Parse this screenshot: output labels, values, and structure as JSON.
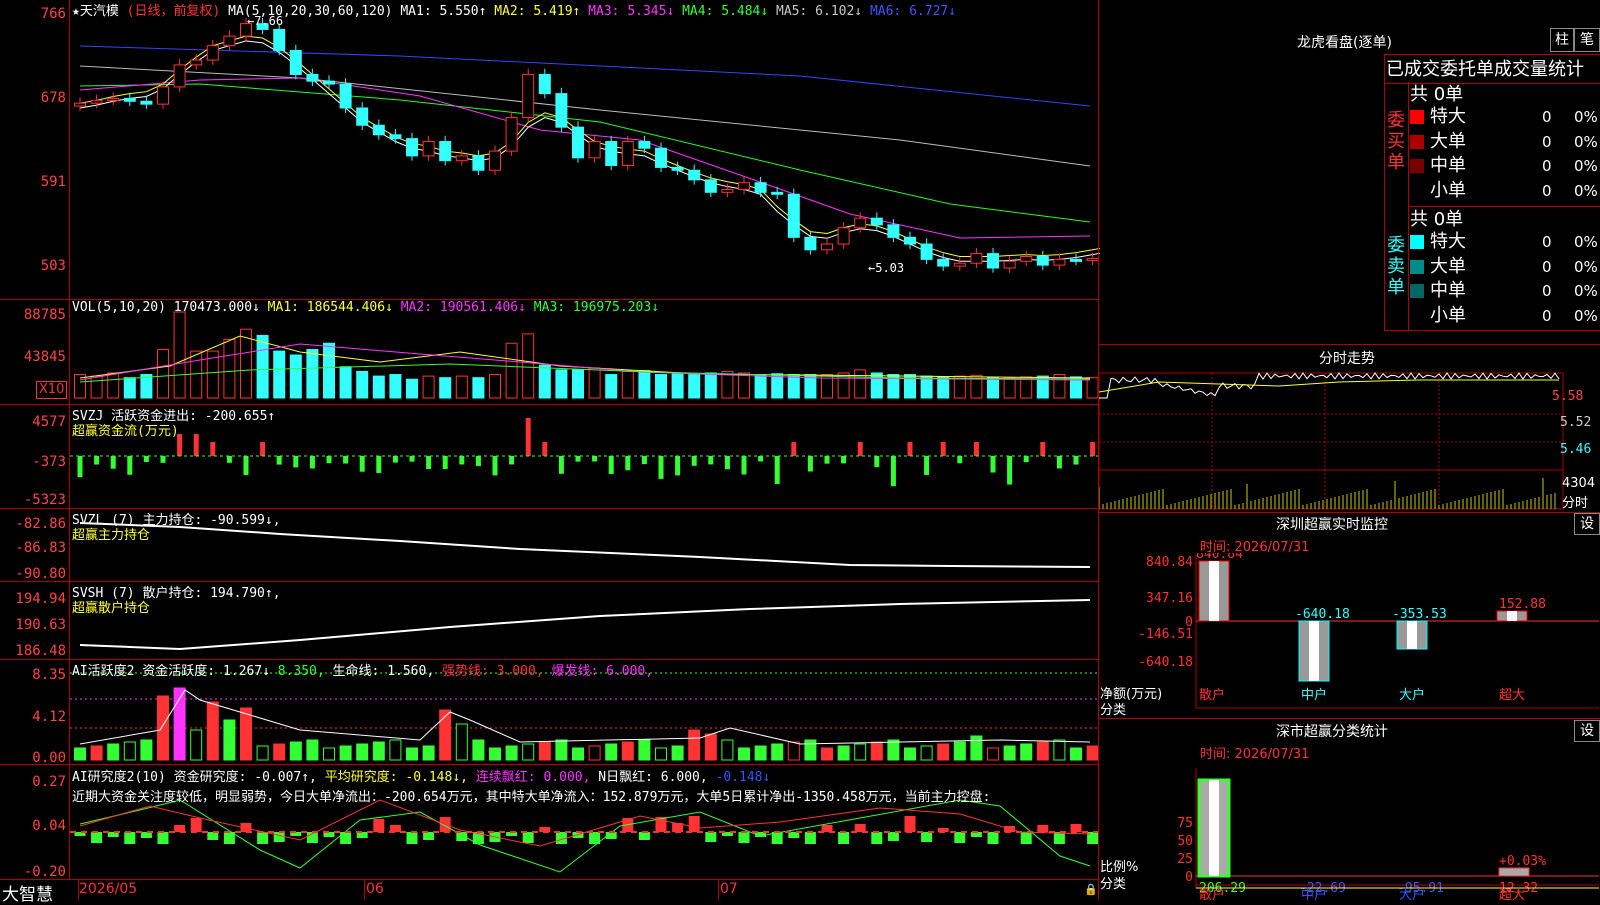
{
  "main": {
    "title": "★天汽模",
    "period": "(日线，前复权)",
    "ma_label": "MA(5,10,20,30,60,120)",
    "ma": [
      {
        "text": "MA1: 5.550↑",
        "color": "#ffffff"
      },
      {
        "text": "MA2: 5.419↑",
        "color": "#ffff33"
      },
      {
        "text": "MA3: 5.345↓",
        "color": "#ff33ff"
      },
      {
        "text": "MA4: 5.484↓",
        "color": "#33ff33"
      },
      {
        "text": "MA5: 6.102↓",
        "color": "#c8c8c8"
      },
      {
        "text": "MA6: 6.727↓",
        "color": "#4455ff"
      }
    ],
    "y_labels": [
      "766",
      "678",
      "591",
      "503"
    ],
    "hi_note": "←7.66",
    "lo_note": "←5.03"
  },
  "vol": {
    "label": "VOL(5,10,20)",
    "items": [
      {
        "text": "170473.000↓",
        "color": "#ffffff"
      },
      {
        "text": "MA1: 186544.406↓",
        "color": "#ffff33"
      },
      {
        "text": "MA2: 190561.406↓",
        "color": "#ff33ff"
      },
      {
        "text": "MA3: 196975.203↓",
        "color": "#33ff33"
      }
    ],
    "y_labels": [
      "88785",
      "43845"
    ],
    "unit": "X10"
  },
  "svzj": {
    "label": "SVZJ  活跃资金进出: -200.655↑",
    "sub": "超赢资金流(万元)",
    "y_labels": [
      "4577",
      "-373",
      "-5323"
    ]
  },
  "svzl": {
    "label": "SVZL (7) 主力持仓: -90.599↓,",
    "sub": "超赢主力持仓",
    "y_labels": [
      "-82.86",
      "-86.83",
      "-90.80"
    ]
  },
  "svsh": {
    "label": "SVSH (7) 散户持仓: 194.790↑,",
    "sub": "超赢散户持仓",
    "y_labels": [
      "194.94",
      "190.63",
      "186.48"
    ]
  },
  "ai1": {
    "items": [
      {
        "text": "AI活跃度2 资金活跃度: 1.267↓",
        "color": "#ffffff"
      },
      {
        "text": "8.350,",
        "color": "#33ff33"
      },
      {
        "text": "生命线: 1.560,",
        "color": "#ffffff"
      },
      {
        "text": "强势线: 3.000,",
        "color": "#ff3333"
      },
      {
        "text": "爆发线: 6.000,",
        "color": "#ff33ff"
      }
    ],
    "y_labels": [
      "8.35",
      "4.12",
      "0.00"
    ]
  },
  "ai2": {
    "items": [
      {
        "text": "AI研究度2(10) 资金研究度: -0.007↑,",
        "color": "#ffffff"
      },
      {
        "text": "平均研究度: -0.148↓,",
        "color": "#ffff33"
      },
      {
        "text": "连续飘红: 0.000,",
        "color": "#ff33ff"
      },
      {
        "text": "N日飘红: 6.000,",
        "color": "#ffffff"
      },
      {
        "text": "-0.148↓",
        "color": "#3355ff"
      }
    ],
    "comment": "近期大资金关注度较低，明显弱势，今日大单净流出：-200.654万元，其中特大单净流入：152.879万元，大单5日累计净出-1350.458万元，当前主力控盘:",
    "y_labels": [
      "0.27",
      "0.04",
      "-0.20"
    ]
  },
  "bottom": {
    "brand": "大智慧",
    "dates": [
      "2026/05",
      "06",
      "07"
    ]
  },
  "dragon": {
    "title": "龙虎看盘(逐单)",
    "btn_a": "柱",
    "btn_b": "笔",
    "header": "已成交委托单成交量统计",
    "buy": {
      "side": "委买单",
      "total": "共 0单",
      "rows": [
        {
          "name": "特大",
          "value": "0",
          "pct": "0%",
          "color": "#ff0000"
        },
        {
          "name": "大单",
          "value": "0",
          "pct": "0%",
          "color": "#aa0000"
        },
        {
          "name": "中单",
          "value": "0",
          "pct": "0%",
          "color": "#770000"
        },
        {
          "name": "小单",
          "value": "0",
          "pct": "0%",
          "color": "#000000"
        }
      ]
    },
    "sell": {
      "side": "委卖单",
      "total": "共 0单",
      "rows": [
        {
          "name": "特大",
          "value": "0",
          "pct": "0%",
          "color": "#00ffff"
        },
        {
          "name": "大单",
          "value": "0",
          "pct": "0%",
          "color": "#008b8b"
        },
        {
          "name": "中单",
          "value": "0",
          "pct": "0%",
          "color": "#006666"
        },
        {
          "name": "小单",
          "value": "0",
          "pct": "0%",
          "color": "#000000"
        }
      ]
    }
  },
  "intraday": {
    "title": "分时走势",
    "y_labels": [
      "5.58",
      "5.52",
      "5.46"
    ],
    "vol_label": "4304",
    "vol_unit": "分时"
  },
  "monitor": {
    "title": "深圳超赢实时监控",
    "btn": "设",
    "time": "时间: 2026/07/31",
    "y_labels": [
      "840.84",
      "347.16",
      "0",
      "-146.51",
      "-640.18"
    ],
    "ylabel": "净额(万元)",
    "xlabel": "分类",
    "categories": [
      "散户",
      "中户",
      "大户",
      "超大"
    ],
    "values": [
      "840.84",
      "-640.18",
      "-353.53",
      "152.88"
    ]
  },
  "classify": {
    "title": "深市超赢分类统计",
    "btn": "设",
    "time": "时间: 2026/07/31",
    "y_labels": [
      "75",
      "50",
      "25",
      "0"
    ],
    "ylabel": "比例%",
    "xlabel": "分类",
    "categories": [
      "散户",
      "中户",
      "大户",
      "超大"
    ],
    "values": [
      "206.29",
      "-22.69",
      "-95.91",
      "12.32"
    ],
    "note": "+0.03%"
  },
  "chart_data": {
    "type": "candlestick",
    "closes": [
      6.75,
      6.78,
      6.8,
      6.77,
      6.74,
      6.92,
      7.15,
      7.2,
      7.35,
      7.45,
      7.58,
      7.52,
      7.3,
      7.05,
      6.98,
      6.95,
      6.7,
      6.52,
      6.42,
      6.38,
      6.2,
      6.35,
      6.15,
      6.2,
      6.05,
      6.25,
      6.6,
      7.05,
      6.85,
      6.5,
      6.18,
      6.35,
      6.1,
      6.35,
      6.28,
      6.08,
      6.05,
      5.95,
      5.82,
      5.85,
      5.92,
      5.82,
      5.8,
      5.35,
      5.22,
      5.28,
      5.45,
      5.55,
      5.48,
      5.35,
      5.28,
      5.12,
      5.05,
      5.08,
      5.18,
      5.03,
      5.1,
      5.15,
      5.06,
      5.12,
      5.11,
      5.13,
      5.2,
      5.27,
      5.3,
      5.33,
      5.37,
      5.42,
      5.35,
      5.45
    ],
    "volume": [
      30,
      28,
      32,
      26,
      30,
      62,
      110,
      60,
      60,
      75,
      88,
      80,
      60,
      55,
      62,
      70,
      40,
      34,
      28,
      30,
      24,
      28,
      26,
      28,
      26,
      30,
      70,
      82,
      42,
      36,
      36,
      38,
      30,
      34,
      35,
      30,
      31,
      30,
      32,
      34,
      32,
      30,
      31,
      30,
      30,
      30,
      32,
      36,
      32,
      30,
      30,
      28,
      27,
      28,
      29,
      26,
      26,
      27,
      28,
      30,
      27,
      26,
      30,
      31,
      30,
      30,
      31,
      29,
      33,
      27
    ],
    "ma5_line": [
      6.7,
      6.73,
      6.77,
      6.8,
      6.82,
      6.9,
      7.05,
      7.18,
      7.3,
      7.35,
      7.4,
      7.38,
      7.28,
      7.15,
      7.0,
      6.85,
      6.7,
      6.55,
      6.45,
      6.35,
      6.28,
      6.25,
      6.2,
      6.18,
      6.15,
      6.18,
      6.3,
      6.5,
      6.6,
      6.55,
      6.42,
      6.3,
      6.25,
      6.22,
      6.2,
      6.12,
      6.05,
      5.98,
      5.92,
      5.88,
      5.85,
      5.8,
      5.62,
      5.48,
      5.36,
      5.34,
      5.4,
      5.44,
      5.42,
      5.36,
      5.28,
      5.2,
      5.14,
      5.1,
      5.1,
      5.1,
      5.11,
      5.12,
      5.11,
      5.12,
      5.14,
      5.17,
      5.2,
      5.24,
      5.28,
      5.32,
      5.35,
      5.38,
      5.39,
      5.42
    ]
  }
}
